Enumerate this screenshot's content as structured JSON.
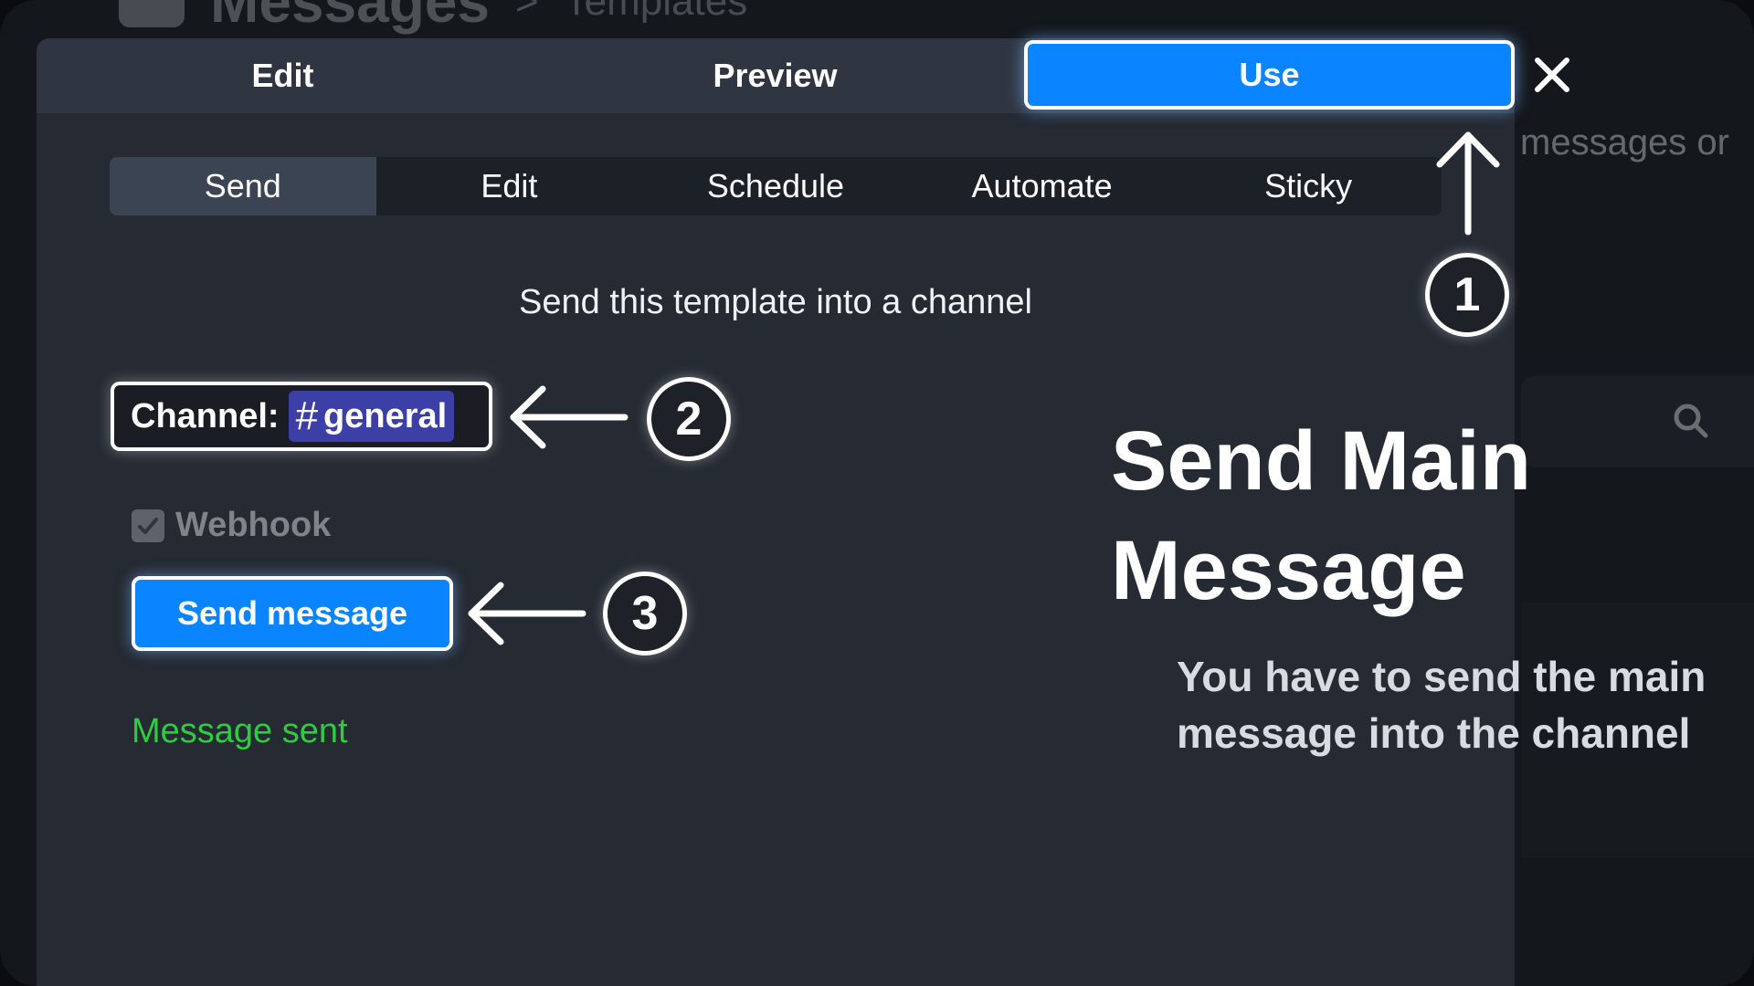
{
  "background": {
    "title": "Messages",
    "separator": ">",
    "subtitle": "Templates",
    "hint_text": "messages or"
  },
  "modal": {
    "top_tabs": [
      {
        "label": "Edit",
        "active": false
      },
      {
        "label": "Preview",
        "active": false
      },
      {
        "label": "Use",
        "active": true
      }
    ],
    "sub_tabs": [
      {
        "label": "Send",
        "active": true
      },
      {
        "label": "Edit",
        "active": false
      },
      {
        "label": "Schedule",
        "active": false
      },
      {
        "label": "Automate",
        "active": false
      },
      {
        "label": "Sticky",
        "active": false
      }
    ],
    "description": "Send this template into a channel",
    "channel": {
      "label": "Channel:",
      "hash": "#",
      "name": "general"
    },
    "webhook": {
      "label": "Webhook",
      "checked": true
    },
    "send_button_label": "Send message",
    "status_text": "Message sent"
  },
  "tutorial": {
    "steps": [
      "1",
      "2",
      "3"
    ],
    "headline": "Send Main Message",
    "subline": "You have to send the main message into the channel"
  },
  "colors": {
    "accent": "#0a84ff",
    "success": "#2ecc40",
    "channel_pill": "#3c3fa6"
  }
}
